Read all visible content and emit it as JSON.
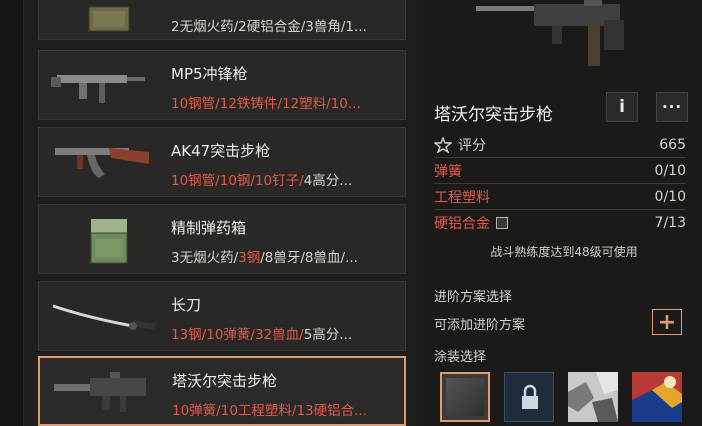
{
  "list": {
    "items": [
      {
        "name": "",
        "mats": [
          [
            "",
            "2无烟火药/2硬铝合金/3兽角/1..."
          ]
        ]
      },
      {
        "name": "MP5冲锋枪",
        "mats": [
          [
            "red",
            "10钢管/12铁铸件/12塑料/10..."
          ]
        ]
      },
      {
        "name": "AK47突击步枪",
        "mats": [
          [
            "red",
            "10钢管/10钢/10钉子/"
          ],
          [
            "",
            "4高分..."
          ]
        ]
      },
      {
        "name": "精制弹药箱",
        "mats": [
          [
            "",
            "3无烟火药/"
          ],
          [
            "red",
            "3钢"
          ],
          [
            "",
            "/8兽牙/8兽血/..."
          ]
        ]
      },
      {
        "name": "长刀",
        "mats": [
          [
            "red",
            "13钢/10弹簧/32兽血/"
          ],
          [
            "",
            "5高分..."
          ]
        ]
      },
      {
        "name": "塔沃尔突击步枪",
        "mats": [
          [
            "red",
            "10弹簧/10工程塑料/13硬铝合..."
          ]
        ]
      }
    ]
  },
  "detail": {
    "title": "塔沃尔突击步枪",
    "info_glyph": "i",
    "more_glyph": "···",
    "score_label": "评分",
    "score_value": "665",
    "stats": [
      {
        "label": "弹簧",
        "value": "0/10"
      },
      {
        "label": "工程塑料",
        "value": "0/10"
      },
      {
        "label": "硬铝合金",
        "value": "7/13"
      }
    ],
    "requirement_note": "战斗熟练度达到48级可使用",
    "upgrade_title": "进阶方案选择",
    "upgrade_hint": "可添加进阶方案",
    "skin_title": "涂装选择"
  },
  "colors": {
    "accent": "#e19a6c",
    "red": "#e0594a"
  }
}
